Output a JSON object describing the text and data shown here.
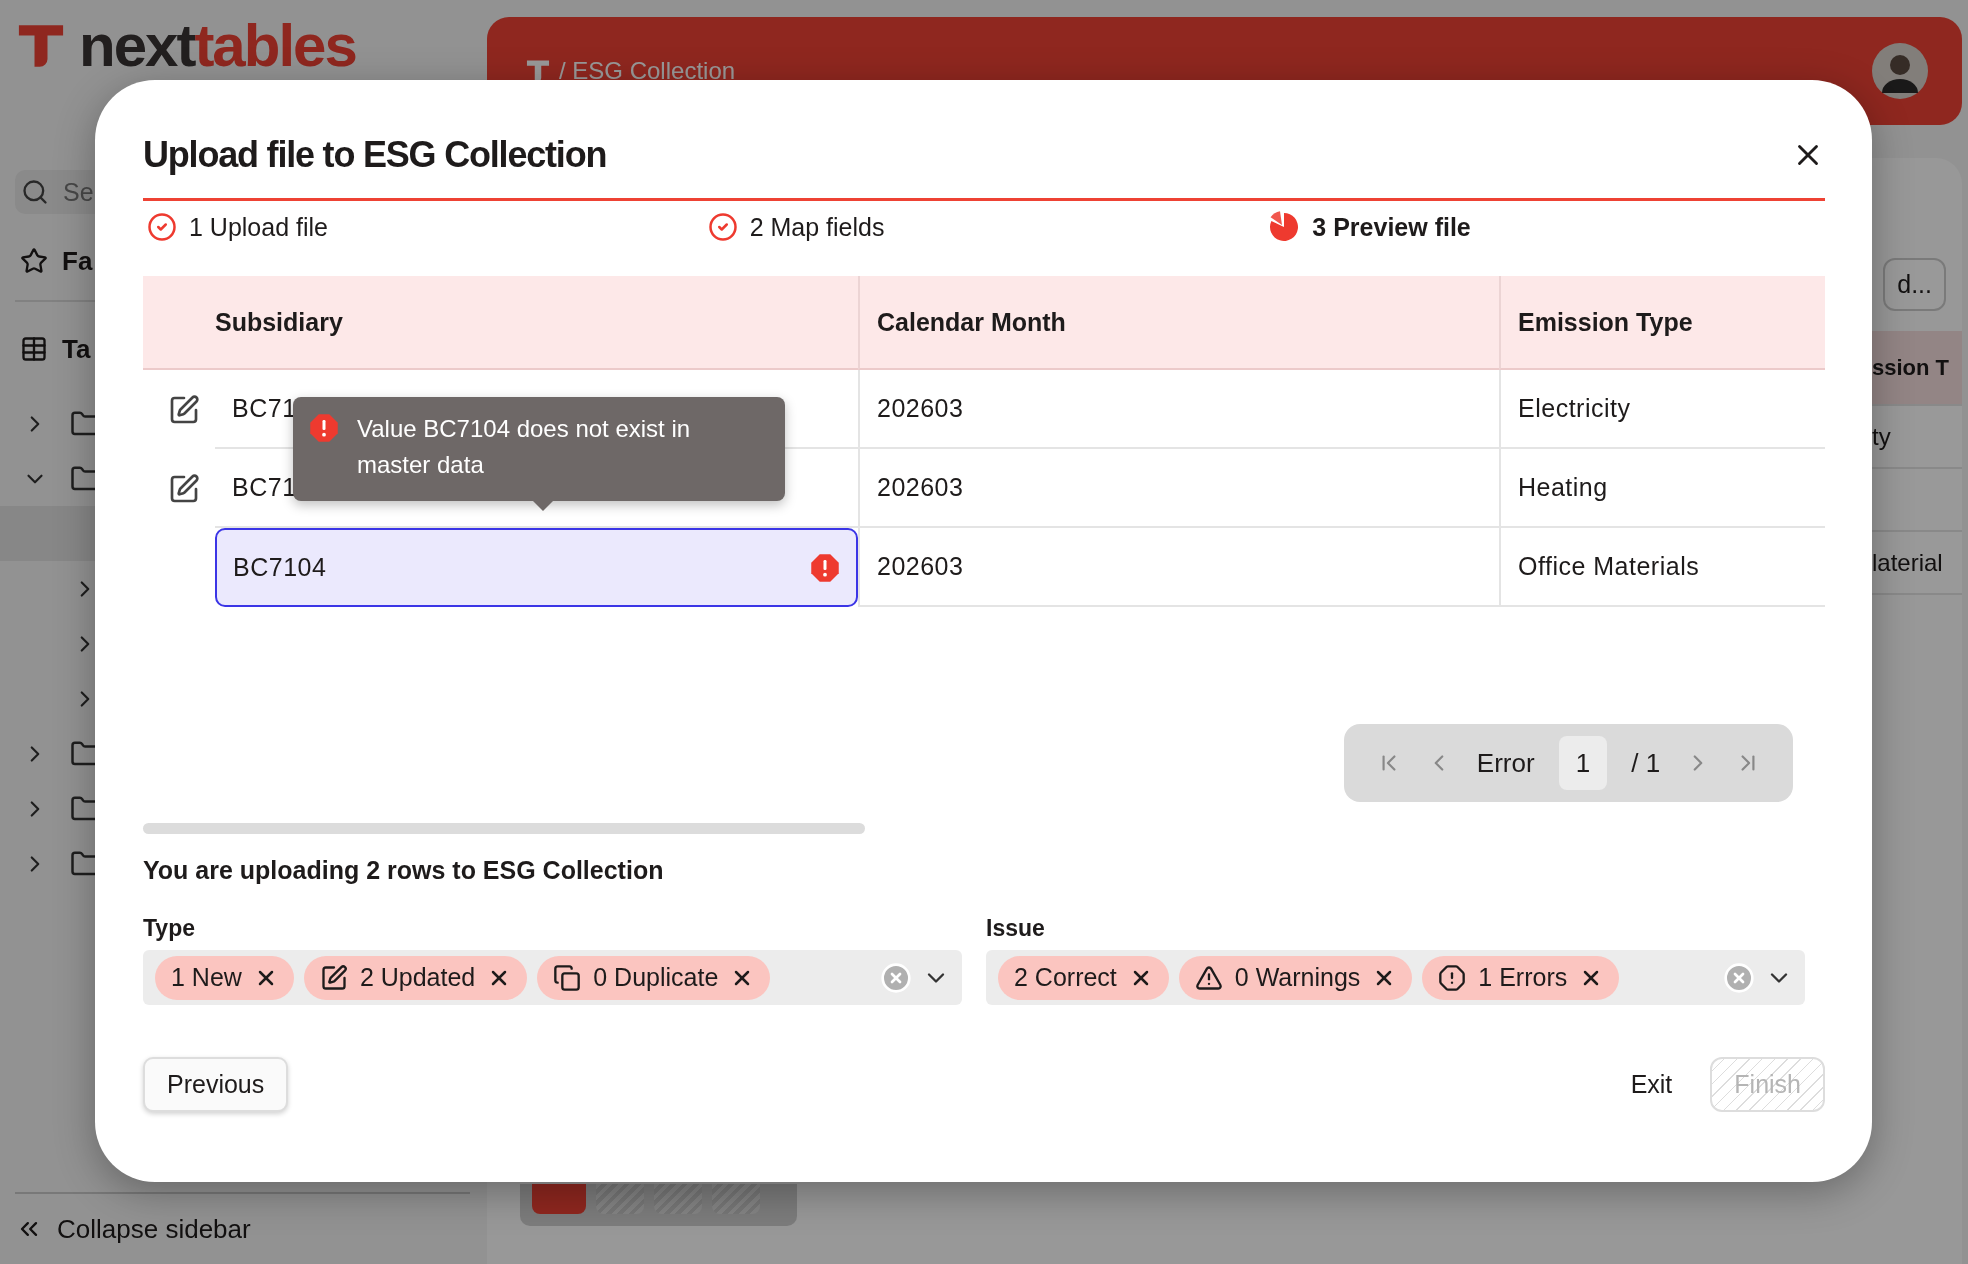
{
  "app": {
    "logo": [
      "next",
      "tables"
    ],
    "breadcrumb": "/ ESG Collection",
    "search": {
      "placeholder": "Se"
    },
    "sidebar_items": [
      {
        "kind": "favorites",
        "label": "Fa"
      },
      {
        "kind": "tables",
        "label": "Ta"
      }
    ],
    "tree": [
      {
        "expanded": false
      },
      {
        "expanded": true,
        "children": [
          {
            "selected": true
          },
          {
            "selected": false,
            "expanded": false
          },
          {
            "selected": false,
            "expanded": false
          },
          {
            "selected": false,
            "expanded": false
          }
        ]
      },
      {
        "expanded": false
      },
      {
        "expanded": false
      },
      {
        "expanded": false
      }
    ],
    "collapse": "Collapse sidebar",
    "toolbar_button": "d...",
    "background_table": {
      "header": "ssion T",
      "cells": [
        "ty",
        "",
        "laterial"
      ]
    }
  },
  "dialog": {
    "title": "Upload file to ESG Collection",
    "steps": [
      {
        "label": "1 Upload file",
        "selected": false
      },
      {
        "label": "2 Map fields",
        "selected": false
      },
      {
        "label": "3 Preview file",
        "selected": true
      }
    ],
    "table": {
      "columns": [
        "Subsidiary",
        "Calendar Month",
        "Emission Type"
      ],
      "rows": [
        {
          "kind": "updated",
          "error": false,
          "cells": [
            "BC71",
            "202603",
            "Electricity"
          ]
        },
        {
          "kind": "updated",
          "error": false,
          "cells": [
            "BC71",
            "202603",
            "Heating"
          ]
        },
        {
          "kind": "new",
          "error": true,
          "cells": [
            "BC7104",
            "202603",
            "Office Materials"
          ]
        }
      ]
    },
    "tooltip": "Value BC7104 does not exist in master data",
    "pagination": {
      "label": "Error",
      "page": "1",
      "total": "/ 1"
    },
    "summary": "You are uploading 2 rows to ESG Collection",
    "filters": [
      {
        "label": "Type",
        "chips": [
          {
            "kind": "new",
            "text": "1 New"
          },
          {
            "kind": "updated",
            "text": "2 Updated"
          },
          {
            "kind": "duplicate",
            "text": "0 Duplicate"
          }
        ]
      },
      {
        "label": "Issue",
        "chips": [
          {
            "kind": "correct",
            "text": "2 Correct"
          },
          {
            "kind": "warning",
            "text": "0 Warnings"
          },
          {
            "kind": "error",
            "text": "1 Errors"
          }
        ]
      }
    ],
    "buttons": {
      "previous": "Previous",
      "exit": "Exit",
      "finish": {
        "label": "Finish",
        "disabled": true
      }
    }
  }
}
